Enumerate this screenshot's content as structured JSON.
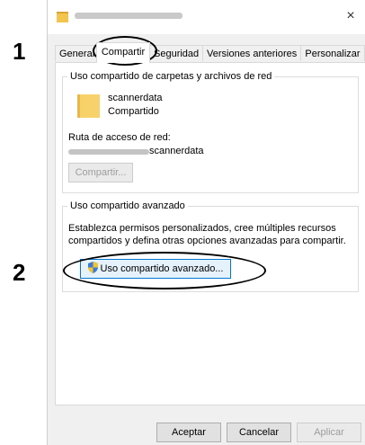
{
  "steps": [
    "1",
    "2"
  ],
  "window": {
    "close_symbol": "×"
  },
  "tabs": [
    {
      "label": "General"
    },
    {
      "label": "Compartir"
    },
    {
      "label": "Seguridad"
    },
    {
      "label": "Versiones anteriores"
    },
    {
      "label": "Personalizar"
    }
  ],
  "network_sharing": {
    "legend": "Uso compartido de carpetas y archivos de red",
    "folder_name": "scannerdata",
    "status": "Compartido",
    "path_label": "Ruta de acceso de red:",
    "path_value": "scannerdata",
    "share_button": "Compartir..."
  },
  "advanced_sharing": {
    "legend": "Uso compartido avanzado",
    "description_line1": "Establezca permisos personalizados, cree múltiples recursos",
    "description_line2": "compartidos y defina otras opciones avanzadas para compartir.",
    "button": "Uso compartido avanzado..."
  },
  "footer": {
    "ok": "Aceptar",
    "cancel": "Cancelar",
    "apply": "Aplicar"
  },
  "colors": {
    "focus_border": "#0078d7",
    "folder": "#f7d26b",
    "dialog_bg": "#f0f0f0"
  }
}
